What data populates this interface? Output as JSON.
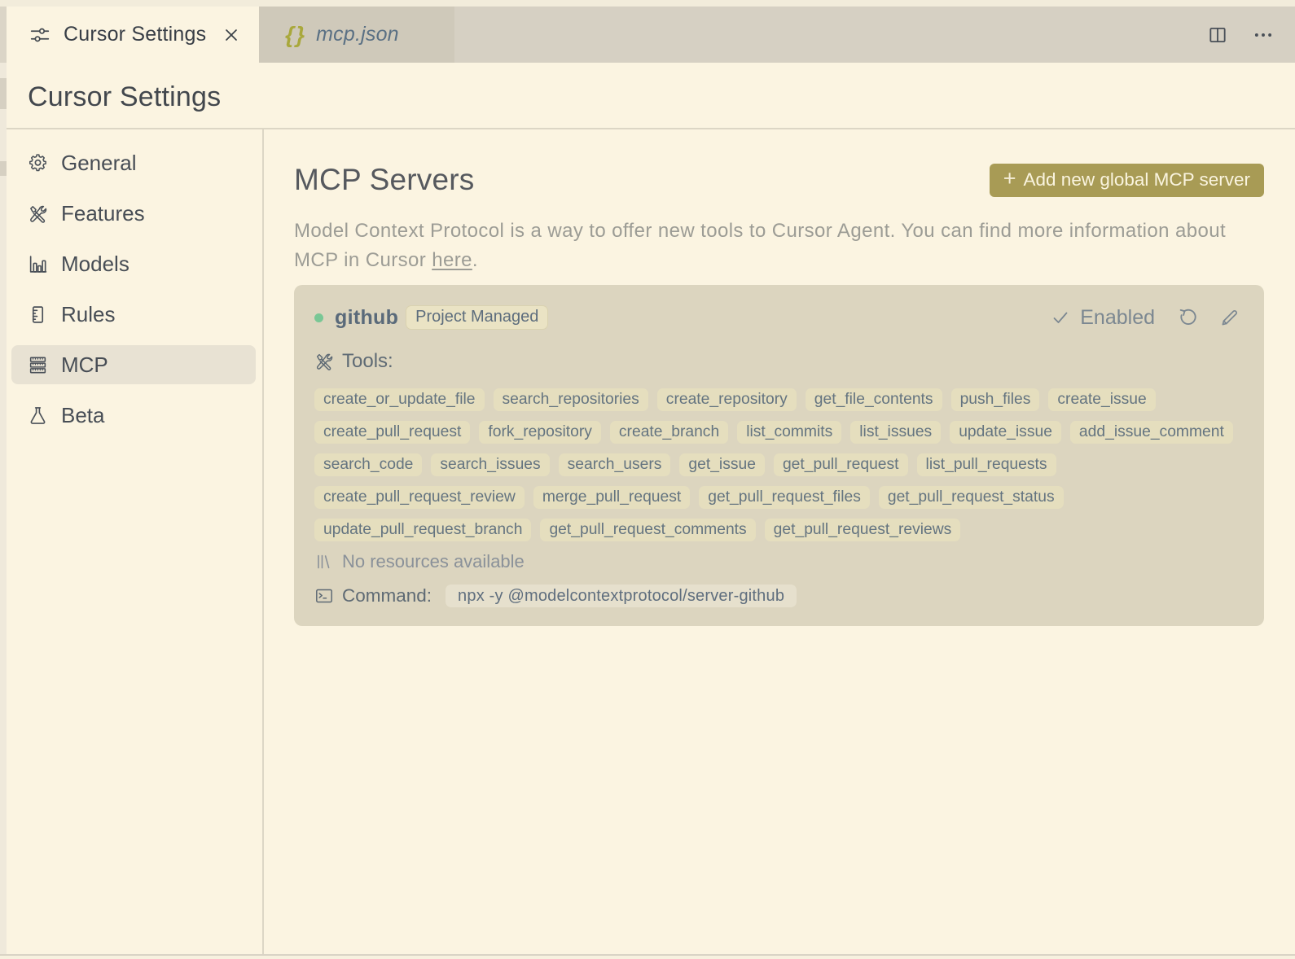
{
  "window": {
    "tabs": [
      {
        "label": "Cursor Settings",
        "icon": "sliders-icon",
        "state": "active"
      },
      {
        "label": "mcp.json",
        "icon": "json-braces-icon",
        "state": "preview"
      }
    ]
  },
  "page": {
    "heading": "Cursor Settings"
  },
  "sidebar": {
    "items": [
      {
        "label": "General",
        "icon": "gear-icon",
        "selected": false
      },
      {
        "label": "Features",
        "icon": "tools-icon",
        "selected": false
      },
      {
        "label": "Models",
        "icon": "bar-chart-icon",
        "selected": false
      },
      {
        "label": "Rules",
        "icon": "ruler-icon",
        "selected": false
      },
      {
        "label": "MCP",
        "icon": "server-stack-icon",
        "selected": true
      },
      {
        "label": "Beta",
        "icon": "beaker-icon",
        "selected": false
      }
    ]
  },
  "main": {
    "title": "MCP Servers",
    "add_button": {
      "plus": "+",
      "label": "Add new global MCP server"
    },
    "description": {
      "line1": "Model Context Protocol is a way to offer new tools to Cursor Agent. You can find more information about",
      "line2_prefix": "MCP in Cursor ",
      "link_text": "here",
      "suffix": "."
    },
    "server": {
      "name": "github",
      "badge": "Project Managed",
      "enabled_label": "Enabled",
      "tools_label": "Tools:",
      "tool_rows": [
        [
          "create_or_update_file",
          "search_repositories",
          "create_repository",
          "get_file_contents",
          "push_files",
          "create_issue"
        ],
        [
          "create_pull_request",
          "fork_repository",
          "create_branch",
          "list_commits",
          "list_issues",
          "update_issue",
          "add_issue_comment"
        ],
        [
          "search_code",
          "search_issues",
          "search_users",
          "get_issue",
          "get_pull_request",
          "list_pull_requests"
        ],
        [
          "create_pull_request_review",
          "merge_pull_request",
          "get_pull_request_files",
          "get_pull_request_status"
        ],
        [
          "update_pull_request_branch",
          "get_pull_request_comments",
          "get_pull_request_reviews"
        ]
      ],
      "resources_label": "No resources available",
      "command_label": "Command:",
      "command": "npx -y @modelcontextprotocol/server-github"
    }
  },
  "colors": {
    "background": "#FBF4E1",
    "tab_strip": "#D6D0C3",
    "card": "#DCD5BF",
    "chip": "#E5DEBE",
    "accent_olive": "#A89B55",
    "status_green": "#79C795",
    "slate_text": "#5D6D7D"
  }
}
